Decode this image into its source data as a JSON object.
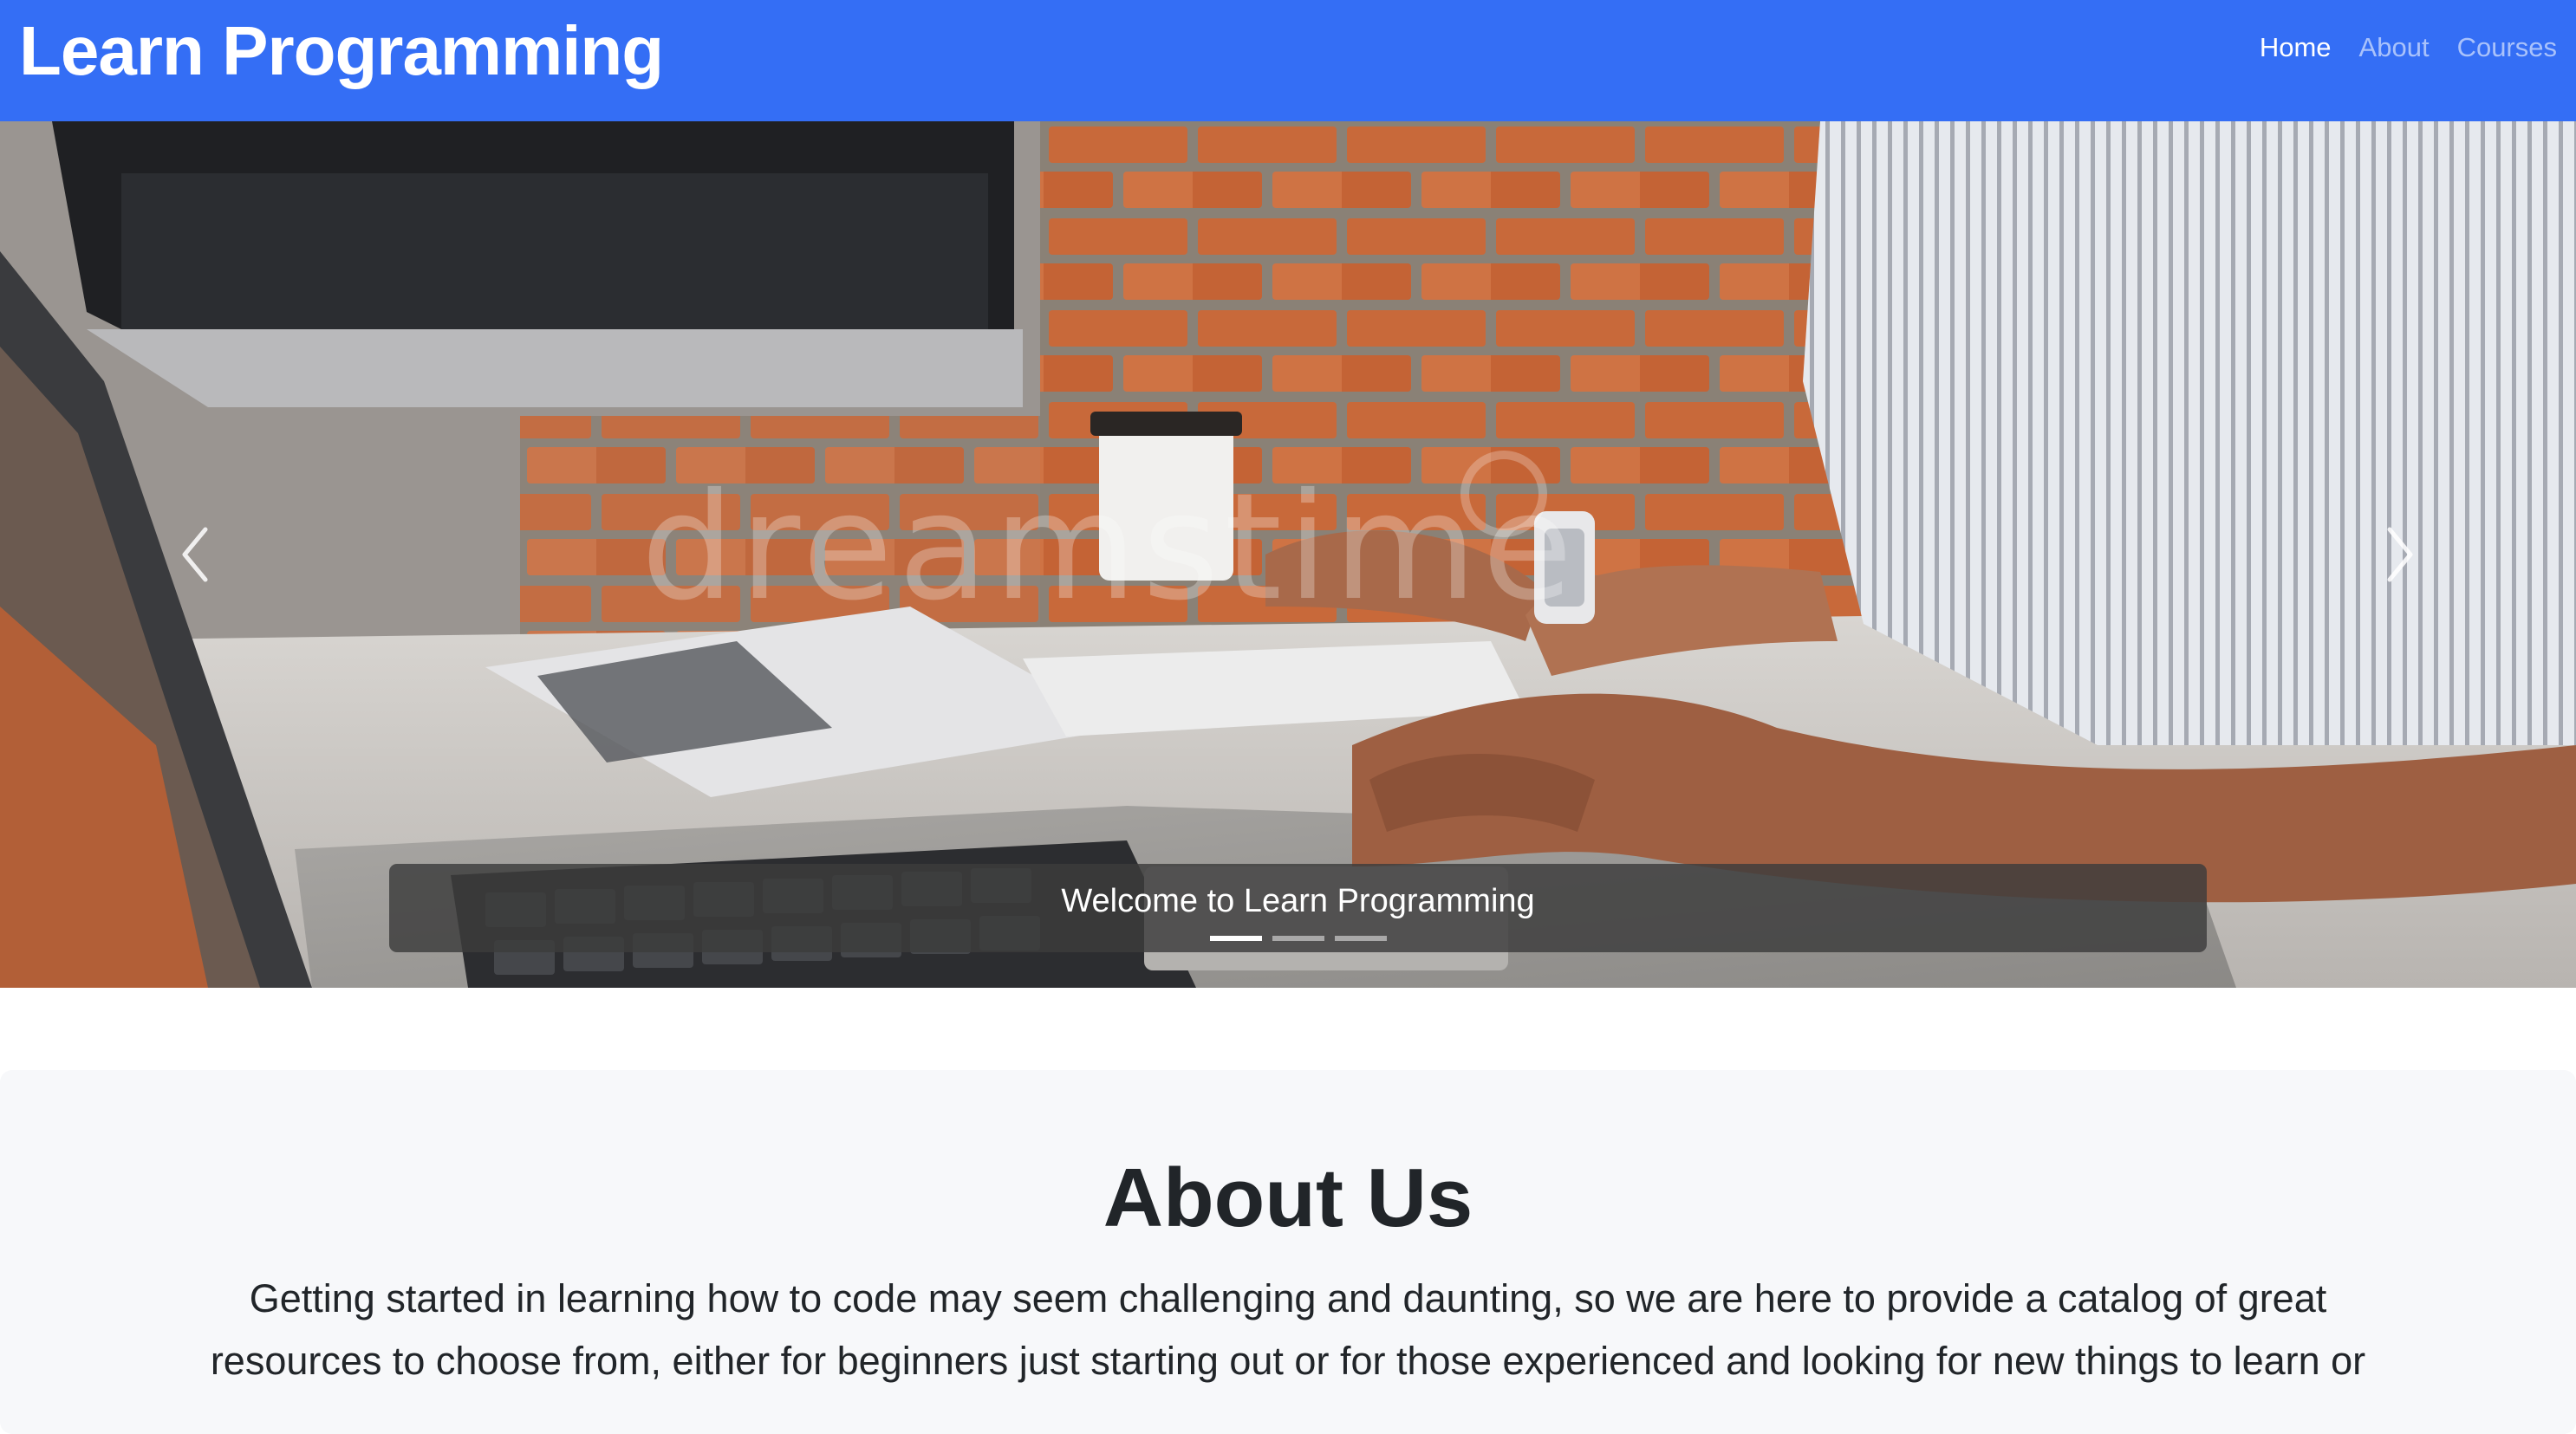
{
  "navbar": {
    "brand": "Learn Programming",
    "links": [
      {
        "label": "Home",
        "active": true
      },
      {
        "label": "About",
        "active": false
      },
      {
        "label": "Courses",
        "active": false
      }
    ],
    "background": "#346ef5"
  },
  "carousel": {
    "slide_image": "woman typing on laptop at desk with brick wall",
    "watermark": "dreamstime",
    "caption": "Welcome to Learn Programming",
    "slide_count": 3,
    "active_slide": 1,
    "prev_icon": "chevron-left-icon",
    "next_icon": "chevron-right-icon"
  },
  "about": {
    "title": "About Us",
    "text": "Getting started in learning how to code may seem challenging and daunting, so we are here to provide a catalog of great resources to choose from, either for beginners just starting out or for those experienced and looking for new things to learn or"
  }
}
